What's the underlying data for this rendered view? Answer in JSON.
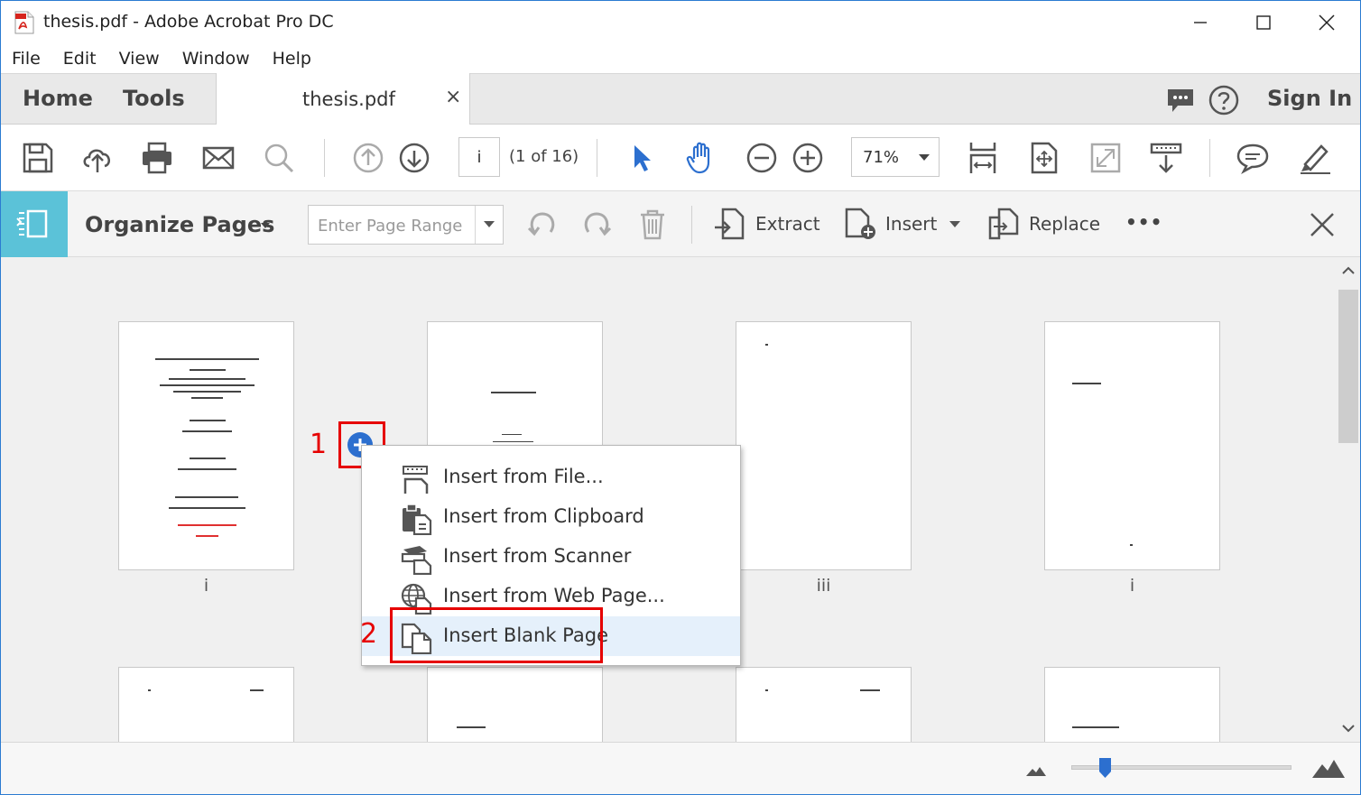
{
  "window": {
    "title": "thesis.pdf - Adobe Acrobat Pro DC"
  },
  "menubar": {
    "items": [
      "File",
      "Edit",
      "View",
      "Window",
      "Help"
    ]
  },
  "tabs": {
    "home": "Home",
    "tools": "Tools",
    "document": "thesis.pdf",
    "close_symbol": "×",
    "sign_in": "Sign In"
  },
  "toolbar": {
    "page_number": "i",
    "page_count": "(1 of 16)",
    "zoom": "71%"
  },
  "organize": {
    "title": "Organize Pages",
    "page_range_placeholder": "Enter Page Range",
    "extract_label": "Extract",
    "insert_label": "Insert",
    "replace_label": "Replace",
    "more_label": "•••"
  },
  "thumbnails": {
    "row1": [
      {
        "label": "i"
      },
      {
        "label": ""
      },
      {
        "label": "iii"
      },
      {
        "label": "i"
      }
    ]
  },
  "annotations": {
    "step1": "1",
    "step2": "2"
  },
  "context_menu": {
    "items": [
      {
        "label": "Insert from File...",
        "icon": "insert-file-icon"
      },
      {
        "label": "Insert from Clipboard",
        "icon": "clipboard-icon"
      },
      {
        "label": "Insert from Scanner",
        "icon": "scanner-icon"
      },
      {
        "label": "Insert from Web Page...",
        "icon": "web-page-icon"
      },
      {
        "label": "Insert Blank Page",
        "icon": "blank-page-icon",
        "highlighted": true
      }
    ]
  },
  "colors": {
    "accent": "#2c6fcf",
    "organize_icon_bg": "#5bc2d8",
    "annotation_red": "#e60000",
    "highlight": "#e5f0fb"
  }
}
